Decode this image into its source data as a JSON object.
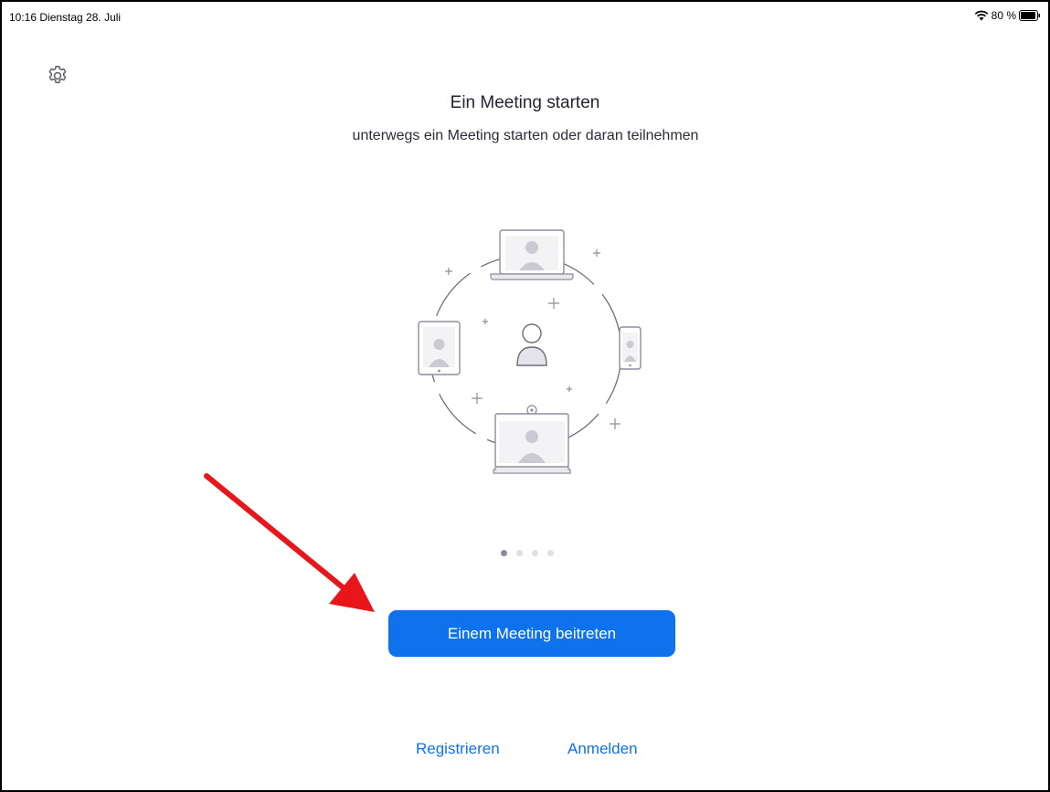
{
  "status": {
    "time_date": "10:16  Dienstag 28. Juli",
    "battery": "80 %"
  },
  "onboarding": {
    "title": "Ein Meeting starten",
    "subtitle": "unterwegs ein Meeting starten oder daran teilnehmen",
    "page_count": 4,
    "active_page": 1
  },
  "actions": {
    "join_label": "Einem Meeting beitreten",
    "register_label": "Registrieren",
    "signin_label": "Anmelden"
  },
  "colors": {
    "accent": "#0e72ed",
    "annotation_arrow": "#e8161b"
  },
  "icons": [
    "gear-icon",
    "wifi-icon",
    "battery-icon"
  ]
}
